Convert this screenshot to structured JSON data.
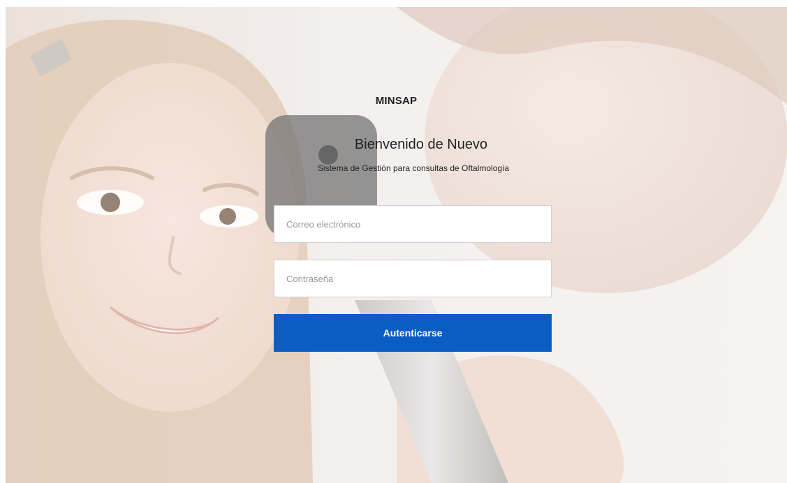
{
  "login": {
    "brand": "MINSAP",
    "welcome_title": "Bienvenido de Nuevo",
    "subtitle": "Sistema de Gestión para consultas de Oftalmología",
    "email": {
      "placeholder": "Correo electrónico",
      "value": ""
    },
    "password": {
      "placeholder": "Contraseña",
      "value": ""
    },
    "submit_label": "Autenticarse"
  },
  "colors": {
    "primary_button": "#0a5dc2",
    "text": "#222222",
    "placeholder": "#9a9a9a",
    "background": "#ece8e6"
  }
}
